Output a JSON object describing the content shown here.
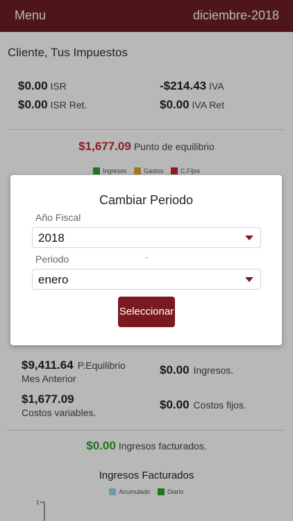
{
  "header": {
    "menu_label": "Menu",
    "period": "diciembre-2018"
  },
  "client_line": "Cliente, Tus Impuestos",
  "taxes": [
    {
      "value": "$0.00",
      "label": "ISR"
    },
    {
      "value": "-$214.43",
      "label": "IVA"
    },
    {
      "value": "$0.00",
      "label": "ISR Ret."
    },
    {
      "value": "$0.00",
      "label": "IVA Ret"
    }
  ],
  "equilibrium": {
    "value": "$1,677.09",
    "label": "Punto de equilibrio"
  },
  "legend_top": [
    {
      "label": "Ingresos",
      "color": "#2fa12f"
    },
    {
      "label": "Gastos",
      "color": "#e6a623"
    },
    {
      "label": "C.Fijos",
      "color": "#c8262a"
    }
  ],
  "stats": {
    "p_equilibrio": {
      "value": "$9,411.64",
      "label": "P.Equilibrio",
      "sub": "Mes Anterior"
    },
    "ingresos": {
      "value": "$0.00",
      "label": "Ingresos."
    },
    "costos_variables": {
      "value": "$1,677.09",
      "sub": "Costos variables."
    },
    "costos_fijos": {
      "value": "$0.00",
      "label": "Costos fijos."
    }
  },
  "facturados": {
    "value": "$0.00",
    "label": "Ingresos facturados."
  },
  "chart": {
    "title": "Ingresos Facturados",
    "legend": [
      {
        "label": "Acumulado",
        "color": "#9fd3e6"
      },
      {
        "label": "Diario",
        "color": "#2fa12f"
      }
    ],
    "y_tick": "1"
  },
  "modal": {
    "title": "Cambiar Periodo",
    "fiscal_year_label": "Año Fiscal",
    "fiscal_year_value": "2018",
    "period_label": "Periodo",
    "period_value": "enero",
    "button_label": "Seleccionar"
  }
}
